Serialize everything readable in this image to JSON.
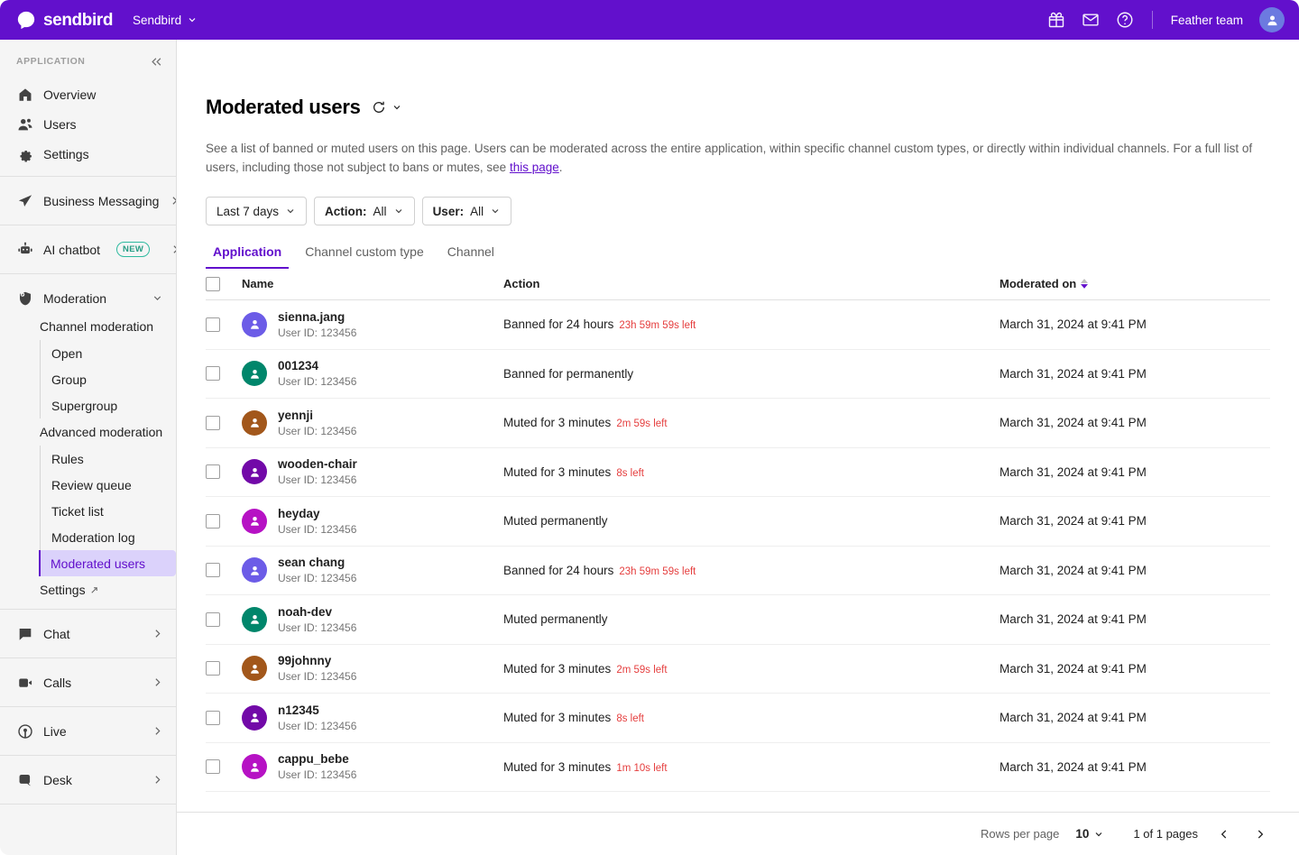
{
  "topbar": {
    "brand": "sendbird",
    "brand_icon": "sendbird-logo-icon",
    "app_switcher_label": "Sendbird",
    "icons": [
      "gift-icon",
      "mail-icon",
      "help-circle-icon"
    ],
    "team_name": "Feather team",
    "avatar_icon": "user-avatar-icon",
    "accent_color": "#6210CC"
  },
  "sidebar": {
    "section_label": "APPLICATION",
    "collapse_icon": "chevrons-left-icon",
    "primary": [
      {
        "label": "Overview",
        "icon": "home-icon"
      },
      {
        "label": "Users",
        "icon": "users-icon"
      },
      {
        "label": "Settings",
        "icon": "gear-icon"
      }
    ],
    "business_messaging": {
      "label": "Business Messaging",
      "icon": "paper-plane-icon",
      "chevron": "chevron-right-icon"
    },
    "ai_chatbot": {
      "label": "AI chatbot",
      "icon": "robot-icon",
      "badge": "NEW",
      "chevron": "chevron-right-icon",
      "badge_color": "#2EBA9F"
    },
    "moderation": {
      "label": "Moderation",
      "icon": "shield-check-icon",
      "chevron": "chevron-down-icon",
      "groups": [
        {
          "title": "Channel moderation",
          "items": [
            "Open",
            "Group",
            "Supergroup"
          ]
        },
        {
          "title": "Advanced moderation",
          "items": [
            "Rules",
            "Review queue",
            "Ticket list",
            "Moderation log",
            "Moderated users"
          ]
        }
      ],
      "active_item": "Moderated users",
      "settings_link": {
        "label": "Settings",
        "icon": "external-link-icon"
      }
    },
    "products": [
      {
        "label": "Chat",
        "icon": "chat-bubble-icon",
        "chevron": "chevron-right-icon"
      },
      {
        "label": "Calls",
        "icon": "video-camera-icon",
        "chevron": "chevron-right-icon"
      },
      {
        "label": "Live",
        "icon": "broadcast-icon",
        "chevron": "chevron-right-icon"
      },
      {
        "label": "Desk",
        "icon": "desk-bubble-icon",
        "chevron": "chevron-right-icon"
      }
    ]
  },
  "page": {
    "title": "Moderated users",
    "refresh_icon": "refresh-icon",
    "refresh_chevron_icon": "chevron-down-icon",
    "description_part1": "See a list of banned or muted users on this page. Users can be moderated across the entire application, within specific channel custom types, or directly within individual channels. For a full list of users, including those not subject to bans or mutes, see ",
    "description_link": "this page",
    "description_part2": "."
  },
  "filters": [
    {
      "label": "",
      "value": "Last 7 days",
      "name": "date-range-filter"
    },
    {
      "label": "Action:",
      "value": "All",
      "name": "action-filter"
    },
    {
      "label": "User:",
      "value": "All",
      "name": "user-filter"
    }
  ],
  "tabs": [
    {
      "label": "Application",
      "active": true
    },
    {
      "label": "Channel custom type",
      "active": false
    },
    {
      "label": "Channel",
      "active": false
    }
  ],
  "table": {
    "columns": {
      "name": "Name",
      "action": "Action",
      "moderated_on": "Moderated on"
    },
    "sort_icon": "sort-arrows-icon",
    "rows": [
      {
        "name": "sienna.jang",
        "user_id": "User ID: 123456",
        "avatar_color": "#6C5CE7",
        "action": "Banned for 24 hours",
        "time_left": "23h 59m 59s left",
        "moderated_on": "March 31, 2024 at 9:41 PM"
      },
      {
        "name": "001234",
        "user_id": "User ID: 123456",
        "avatar_color": "#00866B",
        "action": "Banned for permanently",
        "time_left": "",
        "moderated_on": "March 31, 2024 at 9:41 PM"
      },
      {
        "name": "yennji",
        "user_id": "User ID: 123456",
        "avatar_color": "#A2571B",
        "action": "Muted for 3 minutes",
        "time_left": "2m 59s left",
        "moderated_on": "March 31, 2024 at 9:41 PM"
      },
      {
        "name": "wooden-chair",
        "user_id": "User ID: 123456",
        "avatar_color": "#7209A8",
        "action": "Muted for 3 minutes",
        "time_left": "8s left",
        "moderated_on": "March 31, 2024 at 9:41 PM"
      },
      {
        "name": "heyday",
        "user_id": "User ID: 123456",
        "avatar_color": "#B612C4",
        "action": "Muted permanently",
        "time_left": "",
        "moderated_on": "March 31, 2024 at 9:41 PM"
      },
      {
        "name": "sean chang",
        "user_id": "User ID: 123456",
        "avatar_color": "#6C5CE7",
        "action": "Banned for 24 hours",
        "time_left": "23h 59m 59s left",
        "moderated_on": "March 31, 2024 at 9:41 PM"
      },
      {
        "name": "noah-dev",
        "user_id": "User ID: 123456",
        "avatar_color": "#00866B",
        "action": "Muted permanently",
        "time_left": "",
        "moderated_on": "March 31, 2024 at 9:41 PM"
      },
      {
        "name": "99johnny",
        "user_id": "User ID: 123456",
        "avatar_color": "#A2571B",
        "action": "Muted for 3 minutes",
        "time_left": "2m 59s left",
        "moderated_on": "March 31, 2024 at 9:41 PM"
      },
      {
        "name": "n12345",
        "user_id": "User ID: 123456",
        "avatar_color": "#7209A8",
        "action": "Muted for 3 minutes",
        "time_left": "8s left",
        "moderated_on": "March 31, 2024 at 9:41 PM"
      },
      {
        "name": "cappu_bebe",
        "user_id": "User ID: 123456",
        "avatar_color": "#B612C4",
        "action": "Muted for 3 minutes",
        "time_left": "1m 10s left",
        "moderated_on": "March 31, 2024 at 9:41 PM"
      }
    ]
  },
  "footer": {
    "rows_per_page_label": "Rows per page",
    "rows_per_page_value": "10",
    "pages_label": "1 of 1 pages",
    "prev_icon": "chevron-left-icon",
    "next_icon": "chevron-right-icon"
  }
}
